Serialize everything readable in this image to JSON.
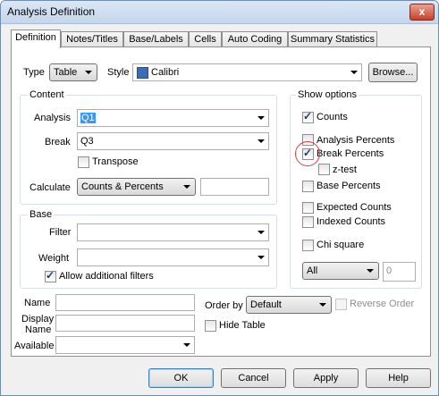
{
  "window": {
    "title": "Analysis Definition",
    "close": "x"
  },
  "tabs": [
    "Definition",
    "Notes/Titles",
    "Base/Labels",
    "Cells",
    "Auto Coding",
    "Summary Statistics"
  ],
  "type": {
    "label": "Type",
    "value": "Table"
  },
  "style": {
    "label": "Style",
    "value": "Calibri",
    "browse": "Browse..."
  },
  "content": {
    "title": "Content",
    "analysis_label": "Analysis",
    "analysis_value": "Q1",
    "break_label": "Break",
    "break_value": "Q3",
    "transpose": "Transpose",
    "calculate_label": "Calculate",
    "calculate_value": "Counts & Percents",
    "calculate_extra": ""
  },
  "base": {
    "title": "Base",
    "filter_label": "Filter",
    "filter_value": "",
    "weight_label": "Weight",
    "weight_value": "",
    "allow_filters": "Allow additional filters"
  },
  "show_options": {
    "title": "Show options",
    "counts": "Counts",
    "analysis_percents": "Analysis Percents",
    "break_percents": "Break Percents",
    "ztest": "z-test",
    "base_percents": "Base Percents",
    "expected_counts": "Expected Counts",
    "indexed_counts": "Indexed Counts",
    "chi_square": "Chi square",
    "all_value": "All",
    "number_value": "0"
  },
  "bottom": {
    "name_label": "Name",
    "display_name_label1": "Display",
    "display_name_label2": "Name",
    "available_label": "Available",
    "order_by_label": "Order by",
    "order_by_value": "Default",
    "reverse_order": "Reverse Order",
    "hide_table": "Hide Table"
  },
  "buttons": {
    "ok": "OK",
    "cancel": "Cancel",
    "apply": "Apply",
    "help": "Help"
  }
}
